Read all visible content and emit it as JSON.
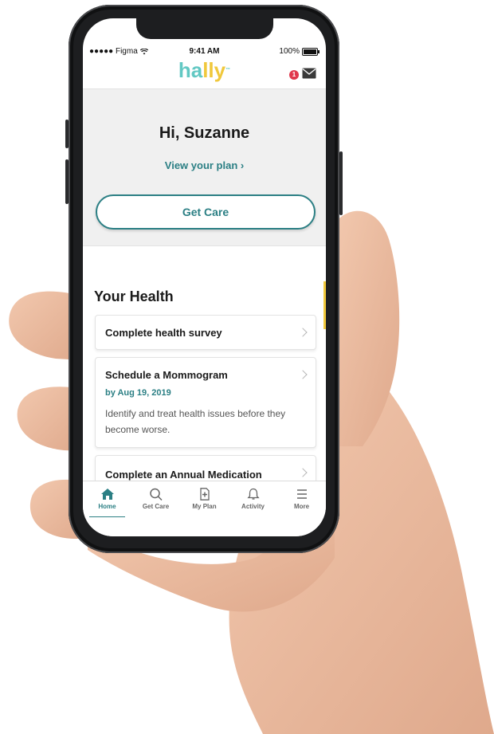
{
  "status_bar": {
    "carrier": "●●●●● Figma",
    "time": "9:41 AM",
    "battery": "100%"
  },
  "header": {
    "logo_part1": "ha",
    "logo_part2": "lly",
    "logo_mark": "™",
    "notification_count": "1",
    "mail_icon": "mail-icon"
  },
  "hero": {
    "greeting": "Hi, Suzanne",
    "plan_link": "View your plan ›",
    "get_care_button": "Get Care"
  },
  "health": {
    "title": "Your Health",
    "items": [
      {
        "title": "Complete health survey"
      },
      {
        "title": "Schedule a Mommogram",
        "due": "by Aug 19, 2019",
        "description": "Identify and treat health issues before they become worse."
      },
      {
        "title": "Complete an Annual Medication"
      }
    ]
  },
  "tabs": [
    {
      "label": "Home",
      "icon": "home-icon",
      "active": true
    },
    {
      "label": "Get Care",
      "icon": "search-icon",
      "active": false
    },
    {
      "label": "My Plan",
      "icon": "plan-document-icon",
      "active": false
    },
    {
      "label": "Activity",
      "icon": "bell-icon",
      "active": false
    },
    {
      "label": "More",
      "icon": "menu-icon",
      "active": false
    }
  ],
  "colors": {
    "brand_teal": "#2b7f84",
    "logo_teal": "#62c8c3",
    "logo_yellow": "#f0c83c",
    "badge_red": "#e0384c",
    "hero_bg": "#f0f0f0"
  }
}
